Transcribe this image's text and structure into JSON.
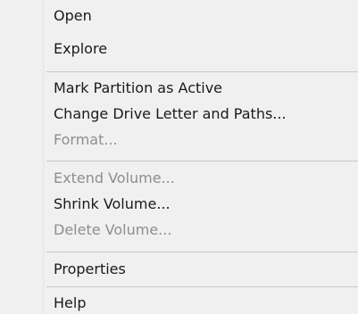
{
  "context_menu": {
    "items": [
      {
        "label": "Open",
        "enabled": true
      },
      {
        "label": "Explore",
        "enabled": true
      },
      {
        "label": "Mark Partition as Active",
        "enabled": true
      },
      {
        "label": "Change Drive Letter and Paths...",
        "enabled": true
      },
      {
        "label": "Format...",
        "enabled": false
      },
      {
        "label": "Extend Volume...",
        "enabled": false
      },
      {
        "label": "Shrink Volume...",
        "enabled": true
      },
      {
        "label": "Delete Volume...",
        "enabled": false
      },
      {
        "label": "Properties",
        "enabled": true
      },
      {
        "label": "Help",
        "enabled": true
      }
    ],
    "colors": {
      "background": "#f0f0f0",
      "enabled_text": "#1a1a1a",
      "disabled_text": "#8e8e8e",
      "separator": "#c8c8c8"
    }
  }
}
